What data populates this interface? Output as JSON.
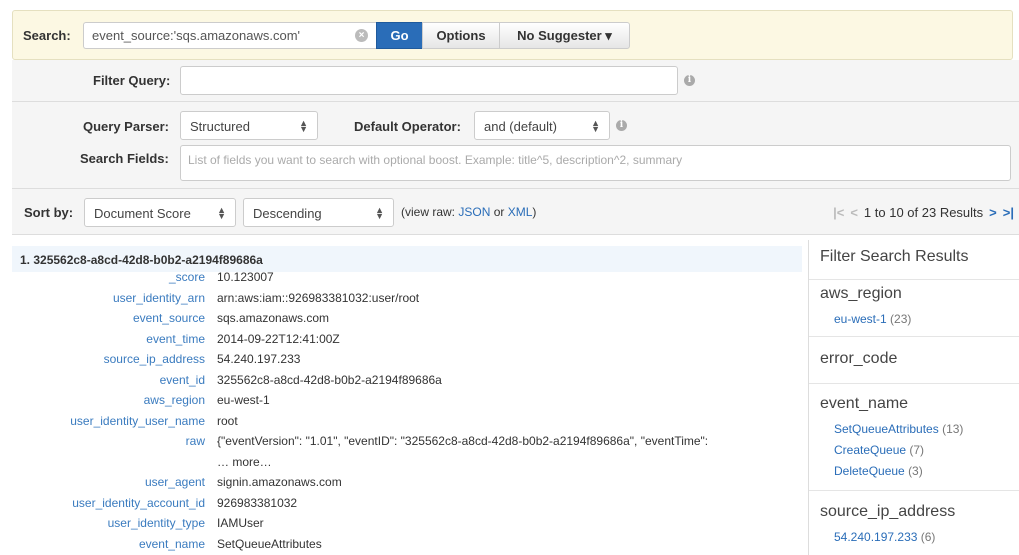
{
  "search": {
    "label": "Search:",
    "value": "event_source:'sqs.amazonaws.com'",
    "go_label": "Go",
    "options_label": "Options",
    "suggester_label": "No Suggester ▾"
  },
  "filter": {
    "label": "Filter Query:",
    "value": ""
  },
  "parser": {
    "label": "Query Parser:",
    "value": "Structured",
    "default_operator_label": "Default Operator:",
    "default_operator_value": "and (default)",
    "search_fields_label": "Search Fields:",
    "search_fields_placeholder": "List of fields you want to search with optional boost. Example: title^5, description^2, summary"
  },
  "sort": {
    "label": "Sort by:",
    "field": "Document Score",
    "order": "Descending",
    "raw_prefix": "(view raw:",
    "raw_json": "JSON",
    "raw_or": "or",
    "raw_xml": "XML",
    "raw_suffix": ")",
    "pager_text": "1 to 10 of 23 Results"
  },
  "result": {
    "header": "1. 325562c8-a8cd-42d8-b0b2-a2194f89686a",
    "fields": [
      {
        "name": "_score",
        "value": "10.123007"
      },
      {
        "name": "user_identity_arn",
        "value": "arn:aws:iam::926983381032:user/root"
      },
      {
        "name": "event_source",
        "value": "sqs.amazonaws.com"
      },
      {
        "name": "event_time",
        "value": "2014-09-22T12:41:00Z"
      },
      {
        "name": "source_ip_address",
        "value": "54.240.197.233"
      },
      {
        "name": "event_id",
        "value": "325562c8-a8cd-42d8-b0b2-a2194f89686a"
      },
      {
        "name": "aws_region",
        "value": "eu-west-1"
      },
      {
        "name": "user_identity_user_name",
        "value": "root"
      },
      {
        "name": "raw",
        "value": "{\"eventVersion\": \"1.01\", \"eventID\": \"325562c8-a8cd-42d8-b0b2-a2194f89686a\", \"eventTime\":"
      },
      {
        "name": "",
        "value": "… more…"
      },
      {
        "name": "user_agent",
        "value": "signin.amazonaws.com"
      },
      {
        "name": "user_identity_account_id",
        "value": "926983381032"
      },
      {
        "name": "user_identity_type",
        "value": "IAMUser"
      },
      {
        "name": "event_name",
        "value": "SetQueueAttributes"
      }
    ]
  },
  "sidebar": {
    "title": "Filter Search Results",
    "aws_region": {
      "heading": "aws_region",
      "items": [
        {
          "label": "eu-west-1",
          "count": "(23)"
        }
      ]
    },
    "error_code": {
      "heading": "error_code"
    },
    "event_name": {
      "heading": "event_name",
      "items": [
        {
          "label": "SetQueueAttributes",
          "count": "(13)"
        },
        {
          "label": "CreateQueue",
          "count": "(7)"
        },
        {
          "label": "DeleteQueue",
          "count": "(3)"
        }
      ]
    },
    "source_ip_address": {
      "heading": "source_ip_address",
      "items": [
        {
          "label": "54.240.197.233",
          "count": "(6)"
        }
      ]
    }
  }
}
